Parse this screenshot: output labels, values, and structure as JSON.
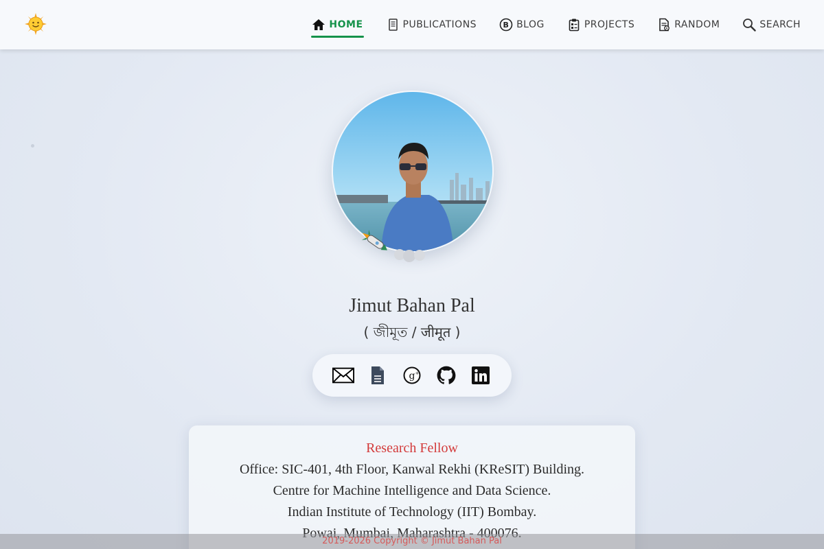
{
  "nav": {
    "items": [
      {
        "label": "HOME",
        "icon": "home-icon",
        "active": true
      },
      {
        "label": "PUBLICATIONS",
        "icon": "document-icon"
      },
      {
        "label": "BLOG",
        "icon": "blog-icon"
      },
      {
        "label": "PROJECTS",
        "icon": "clipboard-icon"
      },
      {
        "label": "RANDOM",
        "icon": "random-page-icon"
      },
      {
        "label": "SEARCH",
        "icon": "search-icon"
      }
    ],
    "active_color": "#15924a"
  },
  "logo": {
    "icon": "sun-icon"
  },
  "profile": {
    "name": "Jimut Bahan Pal",
    "alt_name": "( জীমূত / जीमूत )"
  },
  "social": [
    {
      "icon": "email-icon"
    },
    {
      "icon": "cv-document-icon"
    },
    {
      "icon": "google-scholar-icon"
    },
    {
      "icon": "github-icon"
    },
    {
      "icon": "linkedin-icon"
    }
  ],
  "card": {
    "role": "Research Fellow",
    "lines": [
      "Office: SIC-401, 4th Floor, Kanwal Rekhi (KReSIT) Building.",
      "Centre for Machine Intelligence and Data Science.",
      "Indian Institute of Technology (IIT) Bombay.",
      "Powai, Mumbai, Maharashtra - 400076."
    ],
    "role_color": "#d33a3a"
  },
  "footer": {
    "text": "2019-2026 Copyright © Jimut Bahan Pal"
  }
}
